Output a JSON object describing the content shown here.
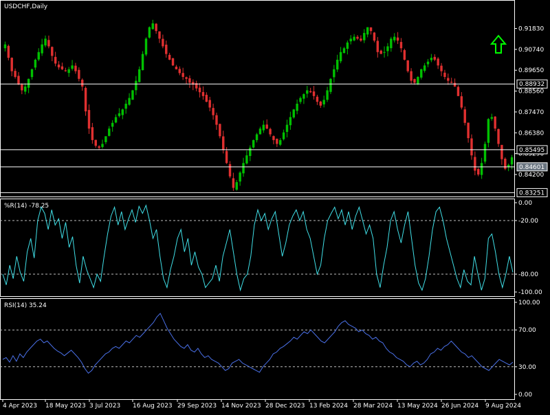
{
  "chart_data": [
    {
      "type": "candlestick",
      "pane": "price",
      "title": "USDCHF,Daily",
      "x_tick_labels": [
        "4 Apr 2023",
        "18 May 2023",
        "3 Jul 2023",
        "16 Aug 2023",
        "29 Sep 2023",
        "14 Nov 2023",
        "28 Dec 2023",
        "13 Feb 2024",
        "28 Mar 2024",
        "13 May 2024",
        "26 Jun 2024",
        "9 Aug 2024"
      ],
      "y_tick_labels": [
        "0.91830",
        "0.90740",
        "0.89650",
        "0.88560",
        "0.87470",
        "0.86380",
        "0.85290",
        "0.84200"
      ],
      "ylim": [
        0.8305,
        0.9325
      ],
      "horizontal_lines": [
        {
          "value": 0.88932,
          "label": "0.88932"
        },
        {
          "value": 0.85495,
          "label": "0.85495"
        },
        {
          "value": 0.84601,
          "label": "0.84601"
        },
        {
          "value": 0.83251,
          "label": "0.83251"
        }
      ],
      "colors": {
        "bull": "#00c000",
        "bear": "#e03030",
        "lines": "#ffffff",
        "arrow": "#00ff00",
        "price_label_bg": "#6a7580"
      },
      "arrow_icon": "up-arrow-icon",
      "path_close": [
        0.91,
        0.903,
        0.896,
        0.893,
        0.889,
        0.886,
        0.888,
        0.892,
        0.897,
        0.902,
        0.906,
        0.91,
        0.913,
        0.909,
        0.904,
        0.9,
        0.898,
        0.897,
        0.896,
        0.897,
        0.899,
        0.896,
        0.892,
        0.888,
        0.875,
        0.866,
        0.86,
        0.857,
        0.856,
        0.858,
        0.862,
        0.866,
        0.869,
        0.872,
        0.874,
        0.876,
        0.879,
        0.882,
        0.886,
        0.891,
        0.897,
        0.905,
        0.913,
        0.919,
        0.921,
        0.917,
        0.913,
        0.909,
        0.905,
        0.902,
        0.899,
        0.897,
        0.895,
        0.893,
        0.892,
        0.89,
        0.889,
        0.887,
        0.885,
        0.883,
        0.88,
        0.877,
        0.873,
        0.868,
        0.862,
        0.855,
        0.848,
        0.841,
        0.835,
        0.838,
        0.843,
        0.848,
        0.852,
        0.856,
        0.86,
        0.863,
        0.866,
        0.868,
        0.866,
        0.863,
        0.86,
        0.858,
        0.86,
        0.864,
        0.868,
        0.872,
        0.876,
        0.879,
        0.882,
        0.884,
        0.886,
        0.885,
        0.883,
        0.88,
        0.878,
        0.881,
        0.886,
        0.892,
        0.897,
        0.902,
        0.906,
        0.908,
        0.911,
        0.913,
        0.914,
        0.913,
        0.912,
        0.916,
        0.919,
        0.917,
        0.912,
        0.906,
        0.905,
        0.906,
        0.909,
        0.913,
        0.914,
        0.912,
        0.908,
        0.902,
        0.896,
        0.891,
        0.89,
        0.893,
        0.897,
        0.899,
        0.901,
        0.903,
        0.902,
        0.899,
        0.896,
        0.893,
        0.891,
        0.89,
        0.888,
        0.883,
        0.877,
        0.869,
        0.861,
        0.852,
        0.844,
        0.842,
        0.848,
        0.858,
        0.871,
        0.872,
        0.866,
        0.858,
        0.85,
        0.845,
        0.847,
        0.851
      ]
    },
    {
      "type": "line",
      "pane": "williams_r",
      "title": "%R(14) -78.25",
      "y_tick_labels": [
        "0.00",
        "-20.00",
        "-80.00",
        "-100.00"
      ],
      "ylim": [
        -100,
        0
      ],
      "levels": [
        -20,
        -80
      ],
      "color": "#40e0e8",
      "path_values": [
        -80,
        -92,
        -70,
        -85,
        -60,
        -78,
        -88,
        -55,
        -40,
        -62,
        -20,
        -5,
        -12,
        -30,
        -8,
        -25,
        -18,
        -40,
        -22,
        -50,
        -38,
        -70,
        -90,
        -60,
        -75,
        -85,
        -95,
        -80,
        -88,
        -60,
        -35,
        -15,
        -5,
        -25,
        -10,
        -30,
        -18,
        -8,
        -22,
        -4,
        -12,
        -3,
        -20,
        -40,
        -30,
        -60,
        -85,
        -95,
        -75,
        -60,
        -40,
        -30,
        -55,
        -40,
        -70,
        -55,
        -72,
        -80,
        -95,
        -90,
        -85,
        -70,
        -88,
        -60,
        -45,
        -30,
        -55,
        -80,
        -98,
        -85,
        -80,
        -60,
        -25,
        -8,
        -20,
        -12,
        -30,
        -18,
        -10,
        -35,
        -60,
        -45,
        -25,
        -15,
        -8,
        -20,
        -10,
        -30,
        -40,
        -60,
        -80,
        -70,
        -40,
        -20,
        -12,
        -5,
        -18,
        -8,
        -25,
        -10,
        -30,
        -15,
        -5,
        -20,
        -35,
        -25,
        -40,
        -80,
        -95,
        -70,
        -50,
        -20,
        -10,
        -30,
        -45,
        -25,
        -10,
        -40,
        -70,
        -90,
        -98,
        -85,
        -60,
        -30,
        -10,
        -5,
        -20,
        -40,
        -55,
        -70,
        -85,
        -95,
        -75,
        -88,
        -92,
        -60,
        -80,
        -98,
        -85,
        -40,
        -35,
        -55,
        -80,
        -95,
        -80,
        -60,
        -78
      ]
    },
    {
      "type": "line",
      "pane": "rsi",
      "title": "RSI(14) 35.24",
      "y_tick_labels": [
        "100.00",
        "70.00",
        "30.00",
        "0.00"
      ],
      "ylim": [
        0,
        100
      ],
      "levels": [
        70,
        30
      ],
      "color": "#4a70e8",
      "path_values": [
        38,
        40,
        35,
        42,
        36,
        44,
        40,
        46,
        50,
        54,
        58,
        60,
        56,
        58,
        54,
        50,
        47,
        45,
        42,
        45,
        48,
        44,
        40,
        35,
        28,
        23,
        26,
        32,
        36,
        40,
        44,
        46,
        50,
        52,
        50,
        54,
        58,
        56,
        60,
        64,
        62,
        66,
        70,
        74,
        78,
        84,
        88,
        80,
        72,
        66,
        60,
        56,
        52,
        50,
        54,
        48,
        46,
        50,
        44,
        40,
        42,
        38,
        36,
        34,
        30,
        26,
        28,
        34,
        36,
        38,
        34,
        32,
        30,
        28,
        26,
        24,
        30,
        34,
        38,
        44,
        46,
        50,
        52,
        55,
        58,
        62,
        60,
        64,
        68,
        66,
        70,
        66,
        62,
        58,
        56,
        60,
        64,
        68,
        74,
        78,
        80,
        76,
        74,
        72,
        68,
        70,
        66,
        64,
        60,
        62,
        58,
        56,
        50,
        46,
        44,
        40,
        38,
        36,
        32,
        30,
        34,
        36,
        32,
        34,
        38,
        44,
        46,
        50,
        48,
        52,
        54,
        58,
        54,
        50,
        46,
        44,
        40,
        42,
        38,
        34,
        30,
        28,
        26,
        30,
        34,
        38,
        36,
        34,
        32,
        35
      ]
    }
  ]
}
